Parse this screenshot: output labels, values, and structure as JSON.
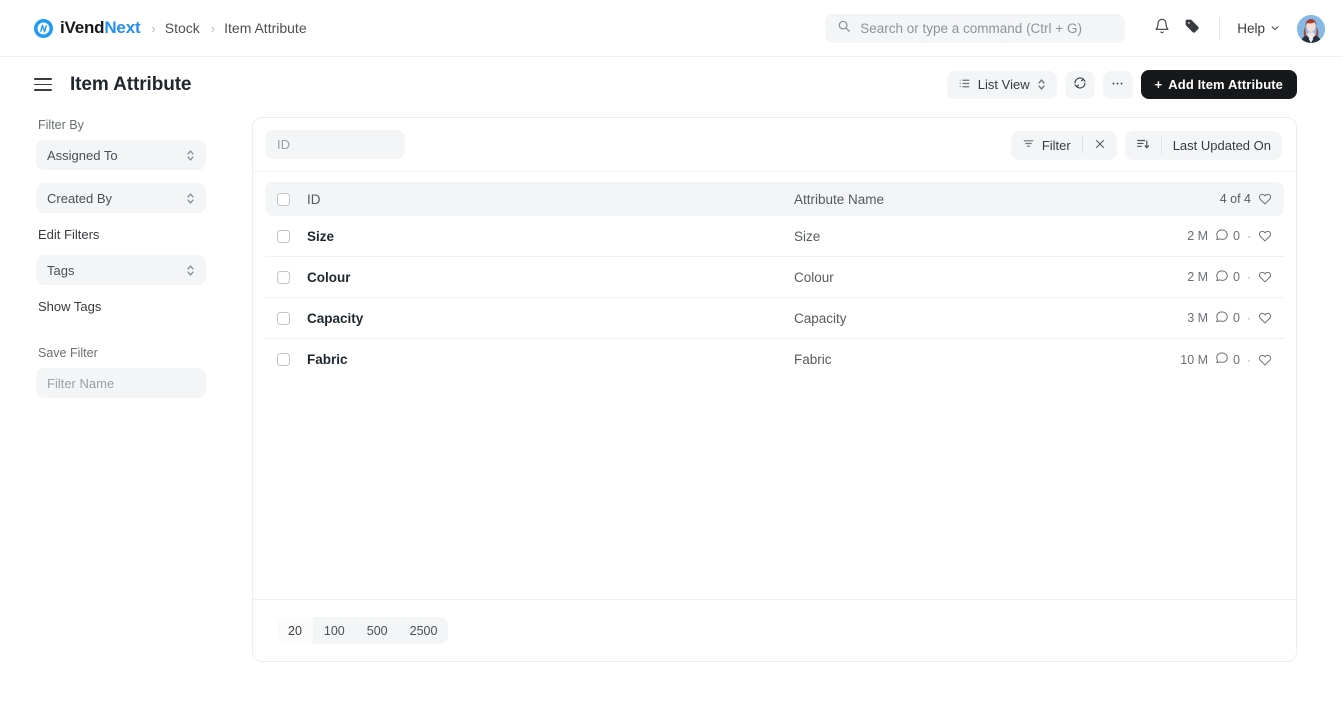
{
  "navbar": {
    "brand_i_vend": "iVend",
    "brand_next": "Next",
    "brand_accent_color": "#2490ef",
    "breadcrumbs": [
      {
        "label": "Stock"
      },
      {
        "label": "Item Attribute"
      }
    ],
    "separator": "›",
    "search": {
      "placeholder": "Search or type a command (Ctrl + G)",
      "value": ""
    },
    "notifications_icon": "bell-icon",
    "tag_icon": "tag-icon",
    "help_label": "Help",
    "avatar_icon": "user-avatar"
  },
  "page_head": {
    "menu_icon": "hamburger-icon",
    "title": "Item Attribute",
    "list_view_label": "List View",
    "refresh_icon": "refresh-icon",
    "more_label": "···",
    "add_button_label": "Add Item Attribute",
    "add_button_plus": "+",
    "add_button_color": "#16181a"
  },
  "sidebar": {
    "filter_by_label": "Filter By",
    "assigned_to_label": "Assigned To",
    "created_by_label": "Created By",
    "edit_filters_label": "Edit Filters",
    "tags_label": "Tags",
    "show_tags_label": "Show Tags",
    "save_filter_label": "Save Filter",
    "filter_name_placeholder": "Filter Name",
    "filter_name_value": ""
  },
  "list_toolbar": {
    "id_placeholder": "ID",
    "id_value": "",
    "filter_label": "Filter",
    "clear_filter_label": "×",
    "sort_label": "Last Updated On"
  },
  "table": {
    "columns": {
      "id": "ID",
      "attribute_name": "Attribute Name"
    },
    "count_label": "4 of 4",
    "rows": [
      {
        "id": "Size",
        "attribute_name": "Size",
        "modified": "2 M",
        "comments": "0",
        "dot": "·"
      },
      {
        "id": "Colour",
        "attribute_name": "Colour",
        "modified": "2 M",
        "comments": "0",
        "dot": "·"
      },
      {
        "id": "Capacity",
        "attribute_name": "Capacity",
        "modified": "3 M",
        "comments": "0",
        "dot": "·"
      },
      {
        "id": "Fabric",
        "attribute_name": "Fabric",
        "modified": "10 M",
        "comments": "0",
        "dot": "·"
      }
    ]
  },
  "pagination": {
    "options": [
      "20",
      "100",
      "500",
      "2500"
    ],
    "active_index": 0
  }
}
